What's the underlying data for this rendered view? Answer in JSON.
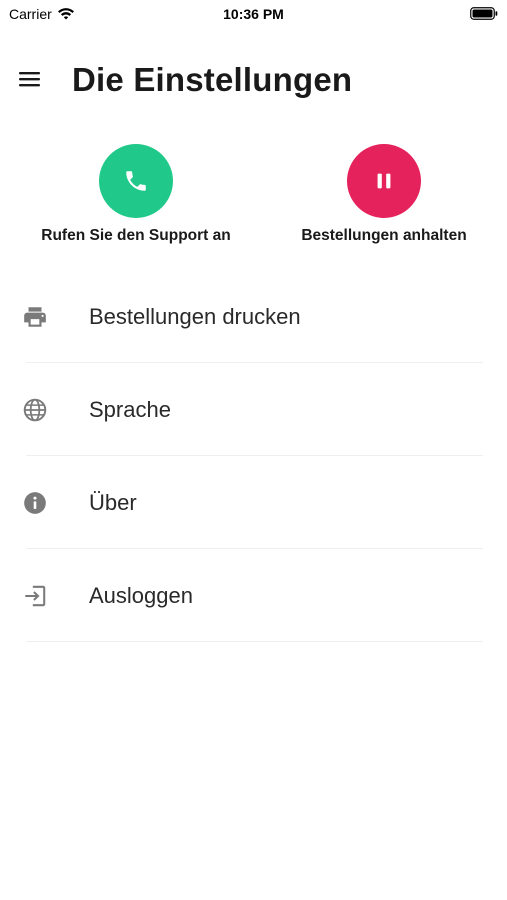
{
  "status_bar": {
    "carrier": "Carrier",
    "time": "10:36 PM"
  },
  "header": {
    "title": "Die Einstellungen",
    "menu_icon": "hamburger-menu-icon"
  },
  "quick_actions": [
    {
      "label": "Rufen Sie den Support an",
      "icon": "phone-icon",
      "color": "#20c989"
    },
    {
      "label": "Bestellungen anhalten",
      "icon": "pause-icon",
      "color": "#e5225b"
    }
  ],
  "settings": [
    {
      "label": "Bestellungen drucken",
      "icon": "printer-icon"
    },
    {
      "label": "Sprache",
      "icon": "globe-icon"
    },
    {
      "label": "Über",
      "icon": "info-icon"
    },
    {
      "label": "Ausloggen",
      "icon": "logout-icon"
    }
  ],
  "colors": {
    "icon_gray": "#7a7a7a",
    "support_green": "#20c989",
    "pause_red": "#e5225b"
  }
}
